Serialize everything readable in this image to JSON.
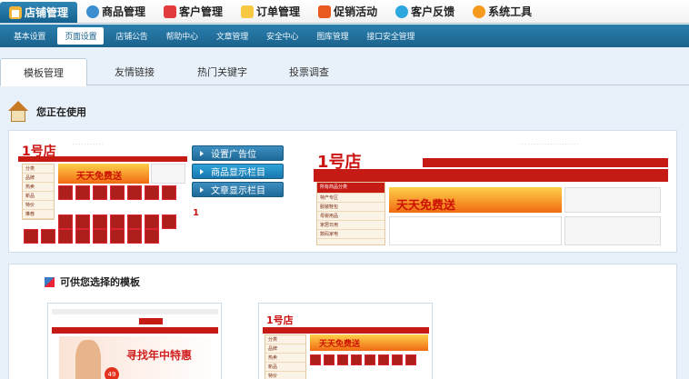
{
  "topnav": [
    {
      "label": "店铺管理",
      "icon": "house-icon",
      "active": true
    },
    {
      "label": "商品管理",
      "icon": "bag-icon"
    },
    {
      "label": "客户管理",
      "icon": "people-icon"
    },
    {
      "label": "订单管理",
      "icon": "pencil-icon"
    },
    {
      "label": "促销活动",
      "icon": "gift-icon"
    },
    {
      "label": "客户反馈",
      "icon": "chat-icon"
    },
    {
      "label": "系统工具",
      "icon": "gear-icon"
    }
  ],
  "subnav": [
    "基本设置",
    "页面设置",
    "店铺公告",
    "帮助中心",
    "文章管理",
    "安全中心",
    "图库管理",
    "接口安全管理"
  ],
  "subnav_active": 1,
  "tabs": [
    "模板管理",
    "友情链接",
    "热门关键字",
    "投票调查"
  ],
  "tabs_active": 0,
  "section1": {
    "title": "您正在使用"
  },
  "section2": {
    "title": "可供您选择的模板"
  },
  "template_buttons": [
    "设置广告位",
    "商品显示栏目",
    "文章显示栏目"
  ],
  "thumb": {
    "logo": "1号店",
    "banner_text": "天天免费送",
    "side_items": [
      "分类",
      "品牌",
      "热卖",
      "新品",
      "特价",
      "推荐"
    ],
    "page_num": "1",
    "big_side_items": [
      "所有商品分类",
      "特产专区",
      "服装鞋包",
      "母婴用品",
      "家居日用",
      "数码家电"
    ],
    "banner2_text": "寻找年中特惠",
    "price": "49"
  },
  "colors": {
    "brand": "#c61a14",
    "menu": "#1a628c"
  }
}
